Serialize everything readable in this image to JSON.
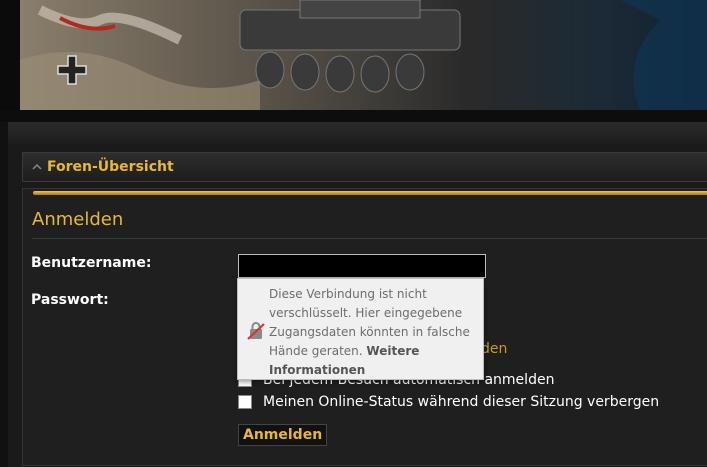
{
  "breadcrumb": {
    "label": "Foren-Übersicht"
  },
  "login": {
    "title": "Anmelden",
    "username_label": "Benutzername:",
    "username_value": "",
    "password_label": "Passwort:",
    "forgot_link_partial": "den",
    "auto_login_label": "Bei jedem Besuch automatisch anmelden",
    "hide_status_label": "Meinen Online-Status während dieser Sitzung verbergen",
    "submit_label": "Anmelden"
  },
  "tooltip": {
    "message": "Diese Verbindung ist nicht verschlüsselt. Hier eingegebene Zugangsdaten könnten in falsche Hände geraten.",
    "link": "Weitere Informationen",
    "icon": "insecure-lock-icon"
  },
  "colors": {
    "accent": "#e8b92e",
    "background": "#1f1f1f"
  }
}
